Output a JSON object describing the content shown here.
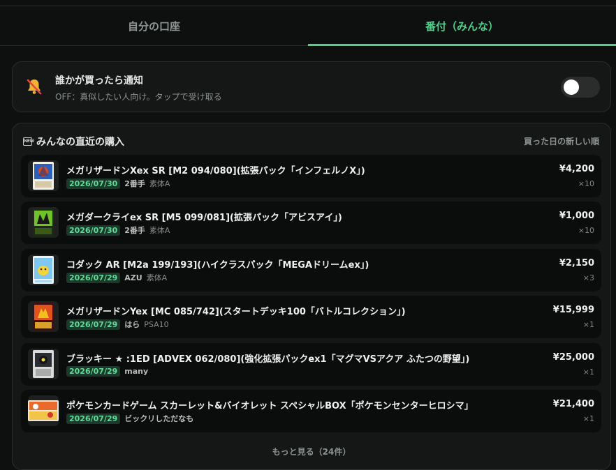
{
  "tabs": [
    {
      "label": "自分の口座",
      "active": false
    },
    {
      "label": "番付（みんな）",
      "active": true
    }
  ],
  "notification": {
    "title": "誰かが買ったら通知",
    "subtitle": "OFF：真似したい人向け。タップで受け取る",
    "toggle_on": false,
    "icon": "bell-off-icon"
  },
  "feed": {
    "icon_text": "NEW",
    "title": "みんなの直近の購入",
    "sort_label": "買った日の新しい順",
    "more_label": "もっと見る（24件）",
    "items": [
      {
        "name": "メガリザードンXex SR [M2 094/080](拡張パック「インフェルノX」)",
        "date": "2026/07/30",
        "user": "2番手",
        "condition": "素体A",
        "price": "¥4,200",
        "qty": "×10",
        "thumb": "card-charizard-x"
      },
      {
        "name": "メガダークライex SR [M5 099/081](拡張パック「アビスアイ」)",
        "date": "2026/07/30",
        "user": "2番手",
        "condition": "素体A",
        "price": "¥1,000",
        "qty": "×10",
        "thumb": "card-darkrai"
      },
      {
        "name": "コダック AR [M2a 199/193](ハイクラスパック「MEGAドリームex」)",
        "date": "2026/07/29",
        "user": "AZU",
        "condition": "素体A",
        "price": "¥2,150",
        "qty": "×3",
        "thumb": "card-psyduck"
      },
      {
        "name": "メガリザードンYex [MC 085/742](スタートデッキ100「バトルコレクション」)",
        "date": "2026/07/29",
        "user": "はら",
        "condition": "PSA10",
        "price": "¥15,999",
        "qty": "×1",
        "thumb": "card-charizard-y"
      },
      {
        "name": "ブラッキー ★ :1ED [ADVEX 062/080](強化拡張パックex1「マグマVSアクア ふたつの野望」)",
        "date": "2026/07/29",
        "user": "many",
        "condition": "",
        "price": "¥25,000",
        "qty": "×1",
        "thumb": "card-umbreon"
      },
      {
        "name": "ポケモンカードゲーム スカーレット&バイオレット スペシャルBOX「ポケモンセンターヒロシマ」",
        "date": "2026/07/29",
        "user": "ビックリしただなも",
        "condition": "",
        "price": "¥21,400",
        "qty": "×1",
        "thumb": "box-special"
      }
    ]
  }
}
